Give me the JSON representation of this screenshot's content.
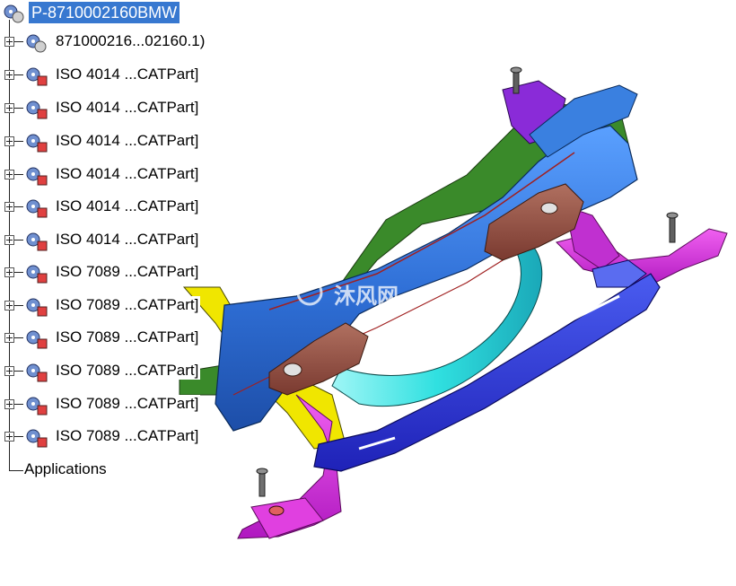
{
  "tree": {
    "root": {
      "label": "P-8710002160BMW",
      "icon": "product-icon",
      "selected": true
    },
    "children": [
      {
        "label": "871000216...02160.1)",
        "icon": "product-icon"
      },
      {
        "label": "ISO 4014 ...CATPart]",
        "icon": "part-icon"
      },
      {
        "label": "ISO 4014 ...CATPart]",
        "icon": "part-icon"
      },
      {
        "label": "ISO 4014 ...CATPart]",
        "icon": "part-icon"
      },
      {
        "label": "ISO 4014 ...CATPart]",
        "icon": "part-icon"
      },
      {
        "label": "ISO 4014 ...CATPart]",
        "icon": "part-icon"
      },
      {
        "label": "ISO 4014 ...CATPart]",
        "icon": "part-icon"
      },
      {
        "label": "ISO 7089 ...CATPart]",
        "icon": "part-icon"
      },
      {
        "label": "ISO 7089 ...CATPart]",
        "icon": "part-icon"
      },
      {
        "label": "ISO 7089 ...CATPart]",
        "icon": "part-icon"
      },
      {
        "label": "ISO 7089 ...CATPart]",
        "icon": "part-icon"
      },
      {
        "label": "ISO 7089 ...CATPart]",
        "icon": "part-icon"
      },
      {
        "label": "ISO 7089 ...CATPart]",
        "icon": "part-icon"
      }
    ],
    "applications": {
      "label": "Applications"
    }
  },
  "watermark": {
    "text": "沐风网"
  },
  "colors": {
    "selection": "#3778d0",
    "crossmember_blue": "#2f6fd6",
    "bracket_brown": "#8a4a3c",
    "arm_magenta": "#d21fd2",
    "arm_yellow": "#f0e600",
    "tube_cyan": "#30e0e0",
    "bracket_purple": "#8a2bd8",
    "bar_blue": "#2a34d8"
  }
}
